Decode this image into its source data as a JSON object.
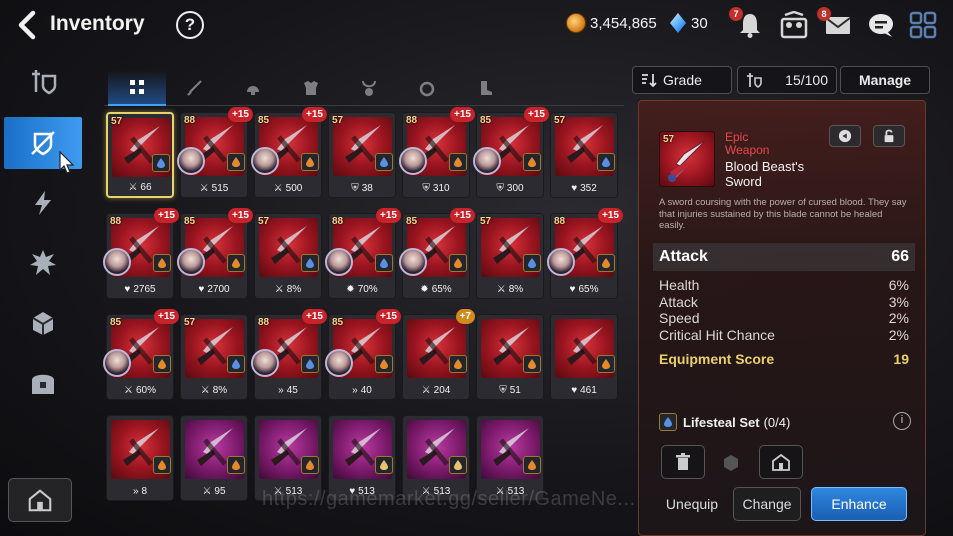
{
  "header": {
    "title": "Inventory",
    "help_glyph": "?",
    "gold": "3,454,865",
    "crystals": "30",
    "icons": [
      {
        "name": "notification-bell-icon",
        "badge": "7"
      },
      {
        "name": "team-icon",
        "badge": ""
      },
      {
        "name": "mail-icon",
        "badge": "8"
      },
      {
        "name": "chat-icon",
        "badge": ""
      },
      {
        "name": "menu-grid-icon",
        "badge": ""
      }
    ]
  },
  "sidebar": {
    "items": [
      {
        "name": "gear-equipment-icon",
        "active": false
      },
      {
        "name": "artifact-icon",
        "active": true
      },
      {
        "name": "lightning-icon",
        "active": false
      },
      {
        "name": "catalyst-icon",
        "active": false
      },
      {
        "name": "materials-icon",
        "active": false
      },
      {
        "name": "chest-icon",
        "active": false
      }
    ],
    "bottom_icon": "house-icon"
  },
  "tabs": [
    {
      "name": "all",
      "active": true
    },
    {
      "name": "weapon",
      "active": false
    },
    {
      "name": "helmet",
      "active": false
    },
    {
      "name": "armor",
      "active": false
    },
    {
      "name": "necklace",
      "active": false
    },
    {
      "name": "ring",
      "active": false
    },
    {
      "name": "boots",
      "active": false
    }
  ],
  "filters": {
    "grade_label": "Grade",
    "capacity": "15/100",
    "manage_label": "Manage"
  },
  "items": [
    {
      "level": "57",
      "plus": "",
      "grade": "epic",
      "stat_icon": "attack",
      "stat": "66",
      "hero": false,
      "set": "lifesteal",
      "selected": true
    },
    {
      "level": "88",
      "plus": "+15",
      "grade": "epic",
      "stat_icon": "attack",
      "stat": "515",
      "hero": true,
      "set": "speed"
    },
    {
      "level": "85",
      "plus": "+15",
      "grade": "epic",
      "stat_icon": "attack",
      "stat": "500",
      "hero": true,
      "set": "speed"
    },
    {
      "level": "57",
      "plus": "",
      "grade": "epic",
      "stat_icon": "defense",
      "stat": "38",
      "hero": false,
      "set": "lifesteal"
    },
    {
      "level": "88",
      "plus": "+15",
      "grade": "epic",
      "stat_icon": "defense",
      "stat": "310",
      "hero": true,
      "set": "counter"
    },
    {
      "level": "85",
      "plus": "+15",
      "grade": "epic",
      "stat_icon": "defense",
      "stat": "300",
      "hero": true,
      "set": "speed"
    },
    {
      "level": "57",
      "plus": "",
      "grade": "epic",
      "stat_icon": "health",
      "stat": "352",
      "hero": false,
      "set": "lifesteal"
    },
    {
      "level": "88",
      "plus": "+15",
      "grade": "epic",
      "stat_icon": "health",
      "stat": "2765",
      "hero": true,
      "set": "speed"
    },
    {
      "level": "85",
      "plus": "+15",
      "grade": "epic",
      "stat_icon": "health",
      "stat": "2700",
      "hero": true,
      "set": "speed"
    },
    {
      "level": "57",
      "plus": "",
      "grade": "epic",
      "stat_icon": "attack",
      "stat": "8%",
      "hero": false,
      "set": "lifesteal"
    },
    {
      "level": "88",
      "plus": "+15",
      "grade": "epic",
      "stat_icon": "critdmg",
      "stat": "70%",
      "hero": true,
      "set": "lifesteal"
    },
    {
      "level": "85",
      "plus": "+15",
      "grade": "epic",
      "stat_icon": "critdmg",
      "stat": "65%",
      "hero": true,
      "set": "destruction"
    },
    {
      "level": "57",
      "plus": "",
      "grade": "epic",
      "stat_icon": "attack",
      "stat": "8%",
      "hero": false,
      "set": "lifesteal"
    },
    {
      "level": "88",
      "plus": "+15",
      "grade": "epic",
      "stat_icon": "health",
      "stat": "65%",
      "hero": true,
      "set": "counter"
    },
    {
      "level": "85",
      "plus": "+15",
      "grade": "epic",
      "stat_icon": "attack",
      "stat": "60%",
      "hero": true,
      "set": "speed"
    },
    {
      "level": "57",
      "plus": "",
      "grade": "epic",
      "stat_icon": "attack",
      "stat": "8%",
      "hero": false,
      "set": "lifesteal"
    },
    {
      "level": "88",
      "plus": "+15",
      "grade": "epic",
      "stat_icon": "speed",
      "stat": "45",
      "hero": true,
      "set": "lifesteal"
    },
    {
      "level": "85",
      "plus": "+15",
      "grade": "epic",
      "stat_icon": "speed",
      "stat": "40",
      "hero": true,
      "set": "speed"
    },
    {
      "level": "",
      "plus": "+7",
      "grade": "epic",
      "stat_icon": "attack",
      "stat": "204",
      "hero": false,
      "set": "counter"
    },
    {
      "level": "",
      "plus": "",
      "grade": "epic",
      "stat_icon": "defense",
      "stat": "51",
      "hero": false,
      "set": "counter"
    },
    {
      "level": "",
      "plus": "",
      "grade": "epic",
      "stat_icon": "health",
      "stat": "461",
      "hero": false,
      "set": "counter"
    },
    {
      "level": "",
      "plus": "",
      "grade": "epic",
      "stat_icon": "speed",
      "stat": "8",
      "hero": false,
      "set": "counter"
    },
    {
      "level": "",
      "plus": "",
      "grade": "heroic",
      "stat_icon": "attack",
      "stat": "95",
      "hero": false,
      "set": "speed"
    },
    {
      "level": "",
      "plus": "",
      "grade": "heroic",
      "stat_icon": "attack",
      "stat": "513",
      "hero": false,
      "set": "speed"
    },
    {
      "level": "",
      "plus": "",
      "grade": "heroic",
      "stat_icon": "health",
      "stat": "513",
      "hero": false,
      "set": "health"
    },
    {
      "level": "",
      "plus": "",
      "grade": "heroic",
      "stat_icon": "attack",
      "stat": "513",
      "hero": false,
      "set": "health"
    },
    {
      "level": "",
      "plus": "",
      "grade": "heroic",
      "stat_icon": "attack",
      "stat": "513",
      "hero": false,
      "set": "speed"
    }
  ],
  "detail": {
    "level": "57",
    "grade": "Epic",
    "type": "Weapon",
    "name": "Blood Beast's Sword",
    "description": "A sword coursing with the power of cursed blood. They say that injuries sustained by this blade cannot be healed easily.",
    "main_stat": {
      "label": "Attack",
      "value": "66"
    },
    "substats": [
      {
        "label": "Health",
        "value": "6%"
      },
      {
        "label": "Attack",
        "value": "3%"
      },
      {
        "label": "Speed",
        "value": "2%"
      },
      {
        "label": "Critical Hit Chance",
        "value": "2%"
      }
    ],
    "score": {
      "label": "Equipment Score",
      "value": "19"
    },
    "set_name": "Lifesteal Set",
    "set_progress": "(0/4)",
    "info_glyph": "i",
    "buttons": {
      "unequip": "Unequip",
      "change": "Change",
      "enhance": "Enhance"
    }
  },
  "watermark": "https://gamemarket.gg/seller/GameNe...",
  "colors": {
    "epic": "#9a1520",
    "heroic": "#7b1a6b",
    "accent": "#2f87e0",
    "score": "#e9d16a"
  }
}
